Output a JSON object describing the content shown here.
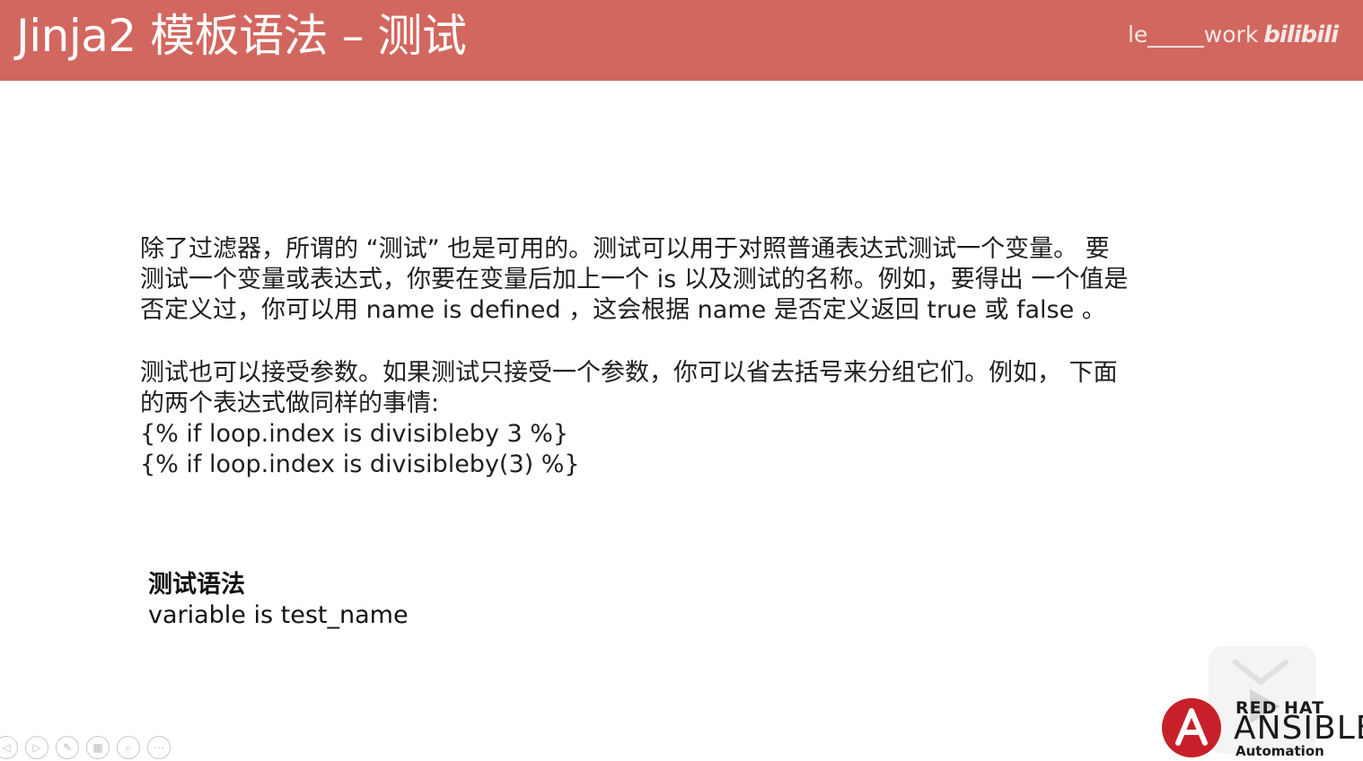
{
  "slide": {
    "title": "Jinja2 模板语法 – 测试",
    "watermark_user": "le_____work",
    "watermark_brand": "bilibili"
  },
  "content": {
    "para1": [
      "除了过滤器，所谓的 “测试” 也是可用的。测试可以用于对照普通表达式测试一个变量。 要",
      "测试一个变量或表达式，你要在变量后加上一个 is 以及测试的名称。例如，要得出 一个值是",
      "否定义过，你可以用 name is defined ，这会根据 name 是否定义返回 true 或 false 。"
    ],
    "para2": [
      "测试也可以接受参数。如果测试只接受一个参数，你可以省去括号来分组它们。例如， 下面",
      "的两个表达式做同样的事情:",
      "{% if loop.index is divisibleby 3 %}",
      "{% if loop.index is divisibleby(3) %}"
    ],
    "syntax_title": "测试语法",
    "syntax_example": "variable is test_name"
  },
  "logo": {
    "line1": "RED HAT",
    "line2": "ANSIBLE",
    "line3": "Automation"
  },
  "controls": [
    {
      "icon": "prev-icon",
      "glyph": "◁"
    },
    {
      "icon": "next-icon",
      "glyph": "▷"
    },
    {
      "icon": "pen-icon",
      "glyph": "✎"
    },
    {
      "icon": "slides-icon",
      "glyph": "▦"
    },
    {
      "icon": "zoom-icon",
      "glyph": "⌕"
    },
    {
      "icon": "more-icon",
      "glyph": "⋯"
    }
  ],
  "colors": {
    "title_bar": "#d2675f",
    "logo_red": "#c8202a"
  }
}
